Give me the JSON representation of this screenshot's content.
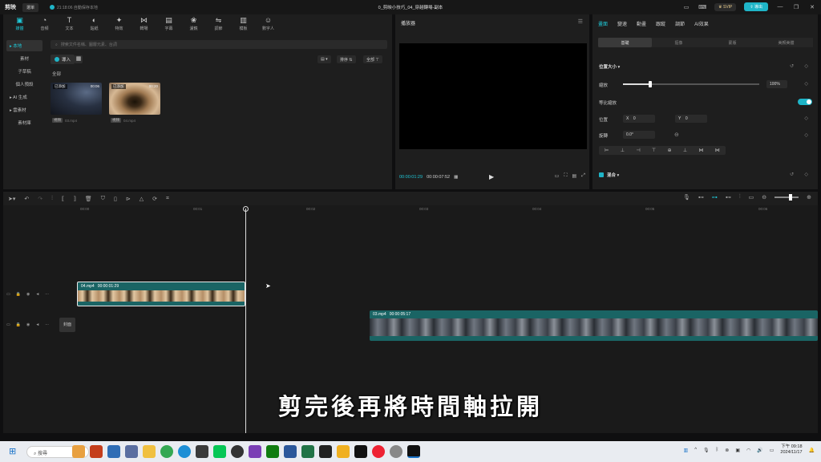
{
  "titlebar": {
    "logo": "剪映",
    "menu": "選單",
    "save_status": "21:18:06 自動保存本地",
    "title": "0_剪映小技巧_04_穿越轉場-副本",
    "vip": "SVIP",
    "share": "導出"
  },
  "toolbar": {
    "items": [
      {
        "label": "媒體",
        "icon": "▣"
      },
      {
        "label": "音頻",
        "icon": "◔"
      },
      {
        "label": "文本",
        "icon": "T"
      },
      {
        "label": "貼紙",
        "icon": "◐"
      },
      {
        "label": "特效",
        "icon": "✦"
      },
      {
        "label": "轉場",
        "icon": "⋈"
      },
      {
        "label": "字幕",
        "icon": "▤"
      },
      {
        "label": "濾鏡",
        "icon": "❀"
      },
      {
        "label": "調節",
        "icon": "⇋"
      },
      {
        "label": "模板",
        "icon": "▥"
      },
      {
        "label": "數字人",
        "icon": "☺"
      }
    ]
  },
  "sidebar": {
    "items": [
      {
        "label": "▸ 本地"
      },
      {
        "label": "素材"
      },
      {
        "label": "子草稿"
      },
      {
        "label": "個人預設"
      },
      {
        "label": "▸ AI 生成"
      },
      {
        "label": "▸ 雲素材"
      },
      {
        "label": "素材庫"
      }
    ]
  },
  "media": {
    "search_placeholder": "搜索文件名稱、圖層元素、台詞",
    "import_label": "導入",
    "sort_label": "排序",
    "filter_label": "全部",
    "all_label": "全部",
    "items": [
      {
        "badge": "已添加",
        "duration": "00:06",
        "tag": "視頻",
        "name": "03.mp4"
      },
      {
        "badge": "已添加",
        "duration": "00:20",
        "tag": "視頻",
        "name": "04.mp4"
      }
    ]
  },
  "player": {
    "title": "播放器",
    "current_time": "00:00:01:29",
    "total_time": "00:00:07:52"
  },
  "inspector": {
    "tabs": [
      "畫面",
      "變速",
      "動畫",
      "跟蹤",
      "調節",
      "AI效果"
    ],
    "subtabs": [
      "基礎",
      "摳像",
      "蒙版",
      "美顏美體"
    ],
    "position_size": "位置大小",
    "scale_label": "縮放",
    "scale_value": "100%",
    "uniform_scale": "等比縮放",
    "position_label": "位置",
    "pos_x_label": "X",
    "pos_x": "0",
    "pos_y_label": "Y",
    "pos_y": "0",
    "rotate_label": "旋轉",
    "rotate_value": "0.0°",
    "blend_label": "混合",
    "scale_fraction": 0.2
  },
  "timeline": {
    "ruler": [
      "00:00",
      "00:01",
      "00:02",
      "00:03",
      "00:04",
      "00:05",
      "00:06"
    ],
    "cover_label": "封面",
    "clip1": {
      "name": "04.mp4",
      "duration": "00:00:01:29"
    },
    "clip2": {
      "name": "03.mp4",
      "duration": "00:00:05:17"
    }
  },
  "subtitle": "剪完後再將時間軸拉開",
  "taskbar": {
    "search_label": "搜尋",
    "time": "下午 09:18",
    "date": "2024/11/17"
  },
  "colors": {
    "accent": "#1fc8d8",
    "clip_green": "#1a6464"
  }
}
